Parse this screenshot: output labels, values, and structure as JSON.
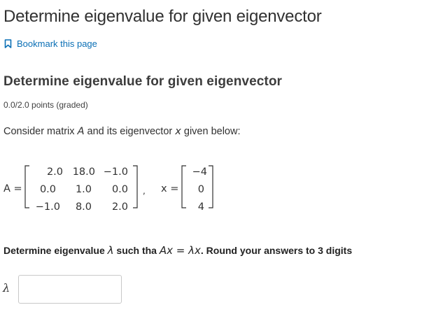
{
  "unit_title": "Determine eigenvalue for given eigenvector",
  "bookmark_label": "Bookmark this page",
  "problem": {
    "title": "Determine eigenvalue for given eigenvector",
    "points": "0.0/2.0 points (graded)",
    "intro_before": "Consider matrix ",
    "intro_A": "A",
    "intro_middle": " and its eigenvector ",
    "intro_x": "x",
    "intro_after": " given below:"
  },
  "matrix": {
    "A_label": "A =",
    "A": [
      [
        "2.0",
        "18.0",
        "−1.0"
      ],
      [
        "0.0",
        "1.0",
        "0.0"
      ],
      [
        "−1.0",
        "8.0",
        "2.0"
      ]
    ],
    "comma": ",",
    "x_label": "x =",
    "x": [
      "−4",
      "0",
      "4"
    ]
  },
  "question": {
    "before": "Determine eigenvalue ",
    "lambda": "λ",
    "mid": " such tha ",
    "equation": "Ax = λx",
    "after": ". Round your answers to 3 digits"
  },
  "answer": {
    "label": "λ",
    "value": ""
  },
  "colors": {
    "link": "#0a6fb5",
    "text": "#313131",
    "input_border": "#c8c8c8"
  },
  "icons": {
    "bookmark": "bookmark-icon"
  }
}
